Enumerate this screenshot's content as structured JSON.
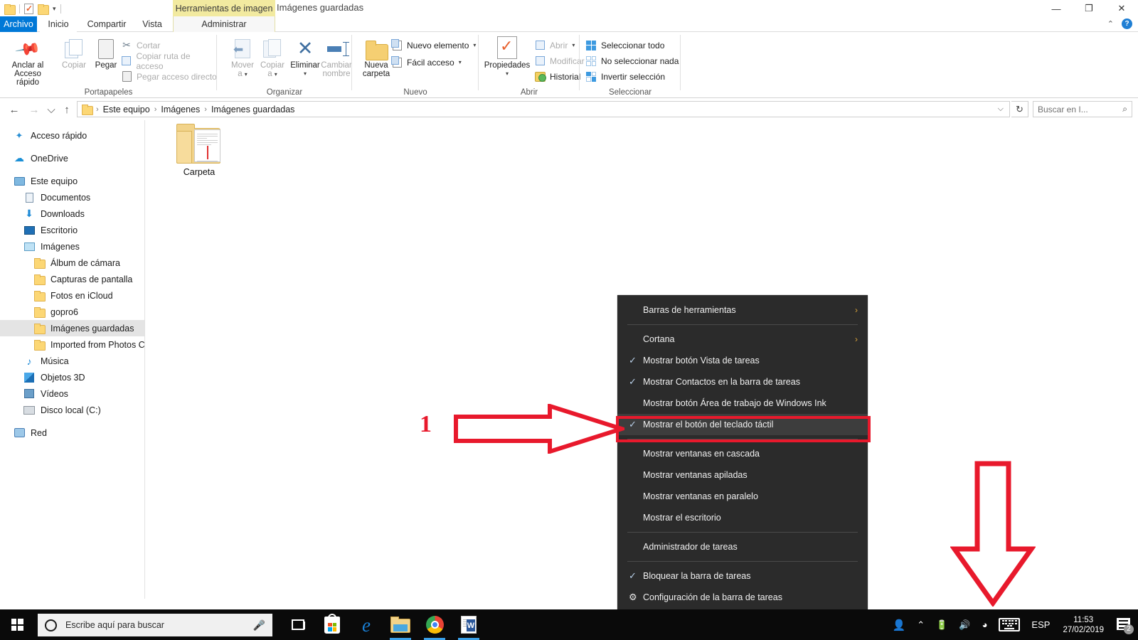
{
  "window": {
    "document_label": "Imágenes guardadas",
    "contextual_tab_group": "Herramientas de imagen",
    "controls": {
      "minimize": "—",
      "maximize": "❐",
      "close": "✕"
    },
    "ribbon_collapse": "⌃",
    "help": "?"
  },
  "tabs": [
    {
      "label": "Archivo",
      "kind": "file"
    },
    {
      "label": "Inicio",
      "kind": "selected"
    },
    {
      "label": "Compartir",
      "kind": "normal"
    },
    {
      "label": "Vista",
      "kind": "normal"
    },
    {
      "label": "Administrar",
      "kind": "contextual"
    }
  ],
  "ribbon": {
    "groups": [
      {
        "name": "Portapapeles"
      },
      {
        "name": "Organizar"
      },
      {
        "name": "Nuevo"
      },
      {
        "name": "Abrir"
      },
      {
        "name": "Seleccionar"
      }
    ],
    "clipboard": {
      "pin_l1": "Anclar al",
      "pin_l2": "Acceso rápido",
      "copy": "Copiar",
      "paste": "Pegar",
      "cut": "Cortar",
      "copy_path": "Copiar ruta de acceso",
      "paste_shortcut": "Pegar acceso directo"
    },
    "organize": {
      "move_l1": "Mover",
      "move_l2": "a",
      "copy_l1": "Copiar",
      "copy_l2": "a",
      "delete": "Eliminar",
      "rename_l1": "Cambiar",
      "rename_l2": "nombre"
    },
    "new": {
      "new_folder_l1": "Nueva",
      "new_folder_l2": "carpeta",
      "new_item": "Nuevo elemento",
      "easy_access": "Fácil acceso"
    },
    "open": {
      "properties": "Propiedades",
      "open": "Abrir",
      "edit": "Modificar",
      "history": "Historial"
    },
    "select": {
      "select_all": "Seleccionar todo",
      "select_none": "No seleccionar nada",
      "invert": "Invertir selección"
    }
  },
  "addressbar": {
    "back": "←",
    "forward": "→",
    "recent": "⌵",
    "up": "↑",
    "breadcrumbs": [
      "Este equipo",
      "Imágenes",
      "Imágenes guardadas"
    ],
    "separator": "›",
    "dropdown": "⌵",
    "refresh": "↻",
    "search_placeholder": "Buscar en I...",
    "search_icon": "⌕"
  },
  "sidebar": {
    "items": [
      {
        "label": "Acceso rápido",
        "icon": "star-icon",
        "indent": 0,
        "selected": false
      },
      {
        "label": "OneDrive",
        "icon": "cloud-icon",
        "indent": 0,
        "selected": false
      },
      {
        "label": "Este equipo",
        "icon": "pc-icon",
        "indent": 0,
        "selected": false
      },
      {
        "label": "Documentos",
        "icon": "documents-icon",
        "indent": 1,
        "selected": false
      },
      {
        "label": "Downloads",
        "icon": "downloads-icon",
        "indent": 1,
        "selected": false
      },
      {
        "label": "Escritorio",
        "icon": "desktop-icon",
        "indent": 1,
        "selected": false
      },
      {
        "label": "Imágenes",
        "icon": "pictures-icon",
        "indent": 1,
        "selected": false
      },
      {
        "label": "Álbum de cámara",
        "icon": "folder-icon",
        "indent": 2,
        "selected": false
      },
      {
        "label": "Capturas de pantalla",
        "icon": "folder-icon",
        "indent": 2,
        "selected": false
      },
      {
        "label": "Fotos en iCloud",
        "icon": "folder-icon",
        "indent": 2,
        "selected": false
      },
      {
        "label": "gopro6",
        "icon": "folder-icon",
        "indent": 2,
        "selected": false
      },
      {
        "label": "Imágenes guardadas",
        "icon": "folder-icon",
        "indent": 2,
        "selected": true
      },
      {
        "label": "Imported from Photos Com",
        "icon": "folder-icon",
        "indent": 2,
        "selected": false
      },
      {
        "label": "Música",
        "icon": "music-icon",
        "indent": 1,
        "selected": false
      },
      {
        "label": "Objetos 3D",
        "icon": "objects3d-icon",
        "indent": 1,
        "selected": false
      },
      {
        "label": "Vídeos",
        "icon": "videos-icon",
        "indent": 1,
        "selected": false
      },
      {
        "label": "Disco local (C:)",
        "icon": "disk-icon",
        "indent": 1,
        "selected": false
      },
      {
        "label": "Red",
        "icon": "network-icon",
        "indent": 0,
        "selected": false
      }
    ]
  },
  "content": {
    "files": [
      {
        "label": "Carpeta",
        "icon": "folder-with-document-icon"
      }
    ]
  },
  "context_menu": {
    "items": [
      {
        "label": "Barras de herramientas",
        "checked": false,
        "submenu": true,
        "sep_after": true,
        "gear": false,
        "highlighted": false
      },
      {
        "label": "Cortana",
        "checked": false,
        "submenu": true,
        "sep_after": false,
        "gear": false,
        "highlighted": false
      },
      {
        "label": "Mostrar botón Vista de tareas",
        "checked": true,
        "submenu": false,
        "sep_after": false,
        "gear": false,
        "highlighted": false
      },
      {
        "label": "Mostrar Contactos en la barra de tareas",
        "checked": true,
        "submenu": false,
        "sep_after": false,
        "gear": false,
        "highlighted": false
      },
      {
        "label": "Mostrar botón Área de trabajo de Windows Ink",
        "checked": false,
        "submenu": false,
        "sep_after": false,
        "gear": false,
        "highlighted": false
      },
      {
        "label": "Mostrar el botón del teclado táctil",
        "checked": true,
        "submenu": false,
        "sep_after": true,
        "gear": false,
        "highlighted": true
      },
      {
        "label": "Mostrar ventanas en cascada",
        "checked": false,
        "submenu": false,
        "sep_after": false,
        "gear": false,
        "highlighted": false
      },
      {
        "label": "Mostrar ventanas apiladas",
        "checked": false,
        "submenu": false,
        "sep_after": false,
        "gear": false,
        "highlighted": false
      },
      {
        "label": "Mostrar ventanas en paralelo",
        "checked": false,
        "submenu": false,
        "sep_after": false,
        "gear": false,
        "highlighted": false
      },
      {
        "label": "Mostrar el escritorio",
        "checked": false,
        "submenu": false,
        "sep_after": true,
        "gear": false,
        "highlighted": false
      },
      {
        "label": "Administrador de tareas",
        "checked": false,
        "submenu": false,
        "sep_after": true,
        "gear": false,
        "highlighted": false
      },
      {
        "label": "Bloquear la barra de tareas",
        "checked": true,
        "submenu": false,
        "sep_after": false,
        "gear": false,
        "highlighted": false
      },
      {
        "label": "Configuración de la barra de tareas",
        "checked": false,
        "submenu": false,
        "sep_after": false,
        "gear": true,
        "highlighted": false
      }
    ],
    "check_glyph": "✓",
    "submenu_glyph": "›",
    "gear_glyph": "⚙"
  },
  "annotations": {
    "step_one": "1",
    "accent_color": "#e8192c"
  },
  "taskbar": {
    "search_placeholder": "Escribe aquí para buscar",
    "apps": [
      {
        "name": "task-view",
        "running": false
      },
      {
        "name": "microsoft-store",
        "running": false
      },
      {
        "name": "microsoft-edge",
        "running": false
      },
      {
        "name": "file-explorer",
        "running": true
      },
      {
        "name": "google-chrome",
        "running": true
      },
      {
        "name": "microsoft-word",
        "running": true
      }
    ],
    "tray": {
      "people": "people-icon",
      "show_hidden": "⌃",
      "battery": "battery-charging-icon",
      "volume": "🔊",
      "network": "wifi-icon",
      "touch_keyboard": "touch-keyboard-icon",
      "language": "ESP",
      "time": "11:53",
      "date": "27/02/2019",
      "notifications_count": "2"
    }
  }
}
